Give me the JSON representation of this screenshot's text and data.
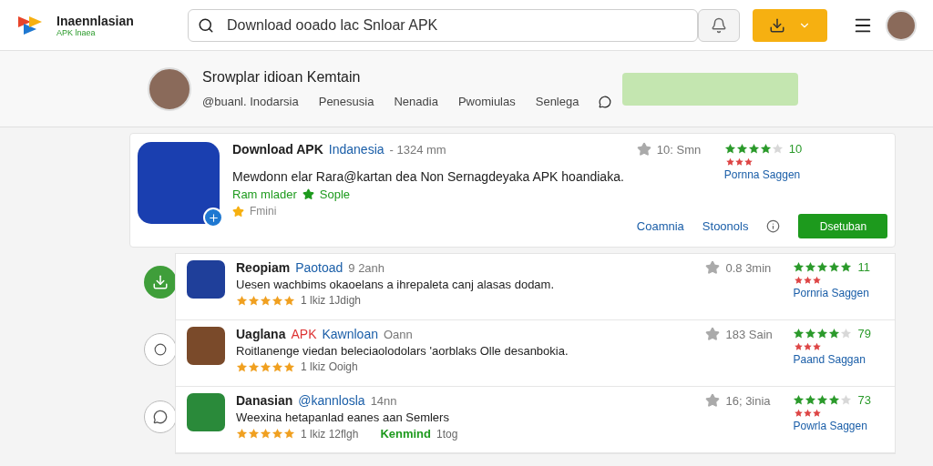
{
  "header": {
    "brand": "Inaennlasian",
    "brand_sub": "APK lnaea",
    "search": {
      "value": "Download ooado lac Snloar APK"
    }
  },
  "profile": {
    "name": "Srowplar idioan Kemtain",
    "links": [
      "@buanl. Inodarsia",
      "Penesusia",
      "Nenadia",
      "Pwomiulas",
      "Senlega"
    ]
  },
  "featured": {
    "title": "Download APK",
    "tag": "Indanesia",
    "time": "- 1324 mm",
    "description": "Mewdonn elar Rara@kartan dea Non Sernagdeyaka APK hoandiaka.",
    "dev": "Ram mlader",
    "dev_tag": "Sople",
    "extra": "Fmini",
    "rating": "10: Smn",
    "stars": 4,
    "count": "10",
    "link": "Pornna Saggen",
    "actions": [
      "Coamnia",
      "Stoonols"
    ],
    "primary": "Dsetuban"
  },
  "sidebar": [
    {
      "selected": true
    },
    {
      "selected": false
    },
    {
      "selected": false
    }
  ],
  "rows": [
    {
      "title": "Reopiam",
      "user": "Paotoad",
      "time": "9 2anh",
      "description": "Uesen wachbims okaoelans a ihrepaleta canj alasas dodam.",
      "meta": {
        "stars": 5,
        "text": "1 lkiz 1Jdigh"
      },
      "rating": "0.8 3min",
      "stars": 5,
      "count": "11",
      "link": "Pornria Saggen"
    },
    {
      "title": "Uaglana",
      "tag": "APK",
      "user": "Kawnloan",
      "time": "Oann",
      "description": "Roitlanenge viedan beleciaolodolars 'aorblaks Olle desanbokia.",
      "meta": {
        "stars": 5,
        "text": "1 lkiz Ooigh"
      },
      "rating": "183 Sain",
      "stars": 4,
      "count": "79",
      "link": "Paand Saggan"
    },
    {
      "title": "Danasian",
      "user": "@kannlosla",
      "time": "14nn",
      "description": "Weexina hetapanlad eanes aan Semlers",
      "meta": {
        "stars": 5,
        "text": "1 lkiz 12flgh"
      },
      "badge": "Kenmind",
      "badge_note": "1tog",
      "rating": "16; 3inia",
      "stars": 4,
      "count": "73",
      "link": "Powrla Saggen"
    }
  ]
}
